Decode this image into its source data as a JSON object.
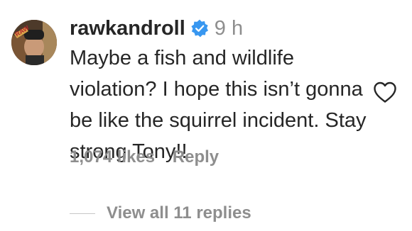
{
  "comment": {
    "username": "rawkandroll",
    "time": "9 h",
    "text": "Maybe a fish and wildlife violation? I hope this isn’t gonna be like the squirrel incident. Stay strong Tony!!",
    "likes": "1,074 likes",
    "reply_label": "Reply",
    "view_replies": "View all 11 replies"
  },
  "icons": {
    "verified": "verified-badge-icon",
    "like": "heart-outline-icon"
  },
  "colors": {
    "text": "#262626",
    "muted": "#8e8e8e",
    "verified": "#3897f0"
  }
}
